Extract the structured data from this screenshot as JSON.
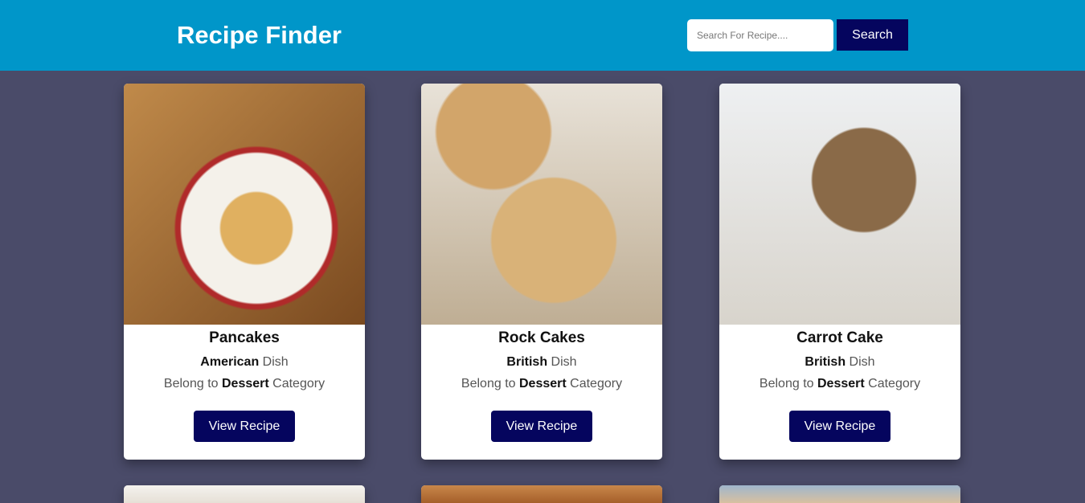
{
  "header": {
    "title": "Recipe Finder",
    "search_placeholder": "Search For Recipe....",
    "search_label": "Search"
  },
  "recipes": [
    {
      "name": "Pancakes",
      "area": "American",
      "dish_suffix": "Dish",
      "category_prefix": "Belong to",
      "category": "Dessert",
      "category_suffix": "Category",
      "button": "View Recipe"
    },
    {
      "name": "Rock Cakes",
      "area": "British",
      "dish_suffix": "Dish",
      "category_prefix": "Belong to",
      "category": "Dessert",
      "category_suffix": "Category",
      "button": "View Recipe"
    },
    {
      "name": "Carrot Cake",
      "area": "British",
      "dish_suffix": "Dish",
      "category_prefix": "Belong to",
      "category": "Dessert",
      "category_suffix": "Category",
      "button": "View Recipe"
    }
  ]
}
